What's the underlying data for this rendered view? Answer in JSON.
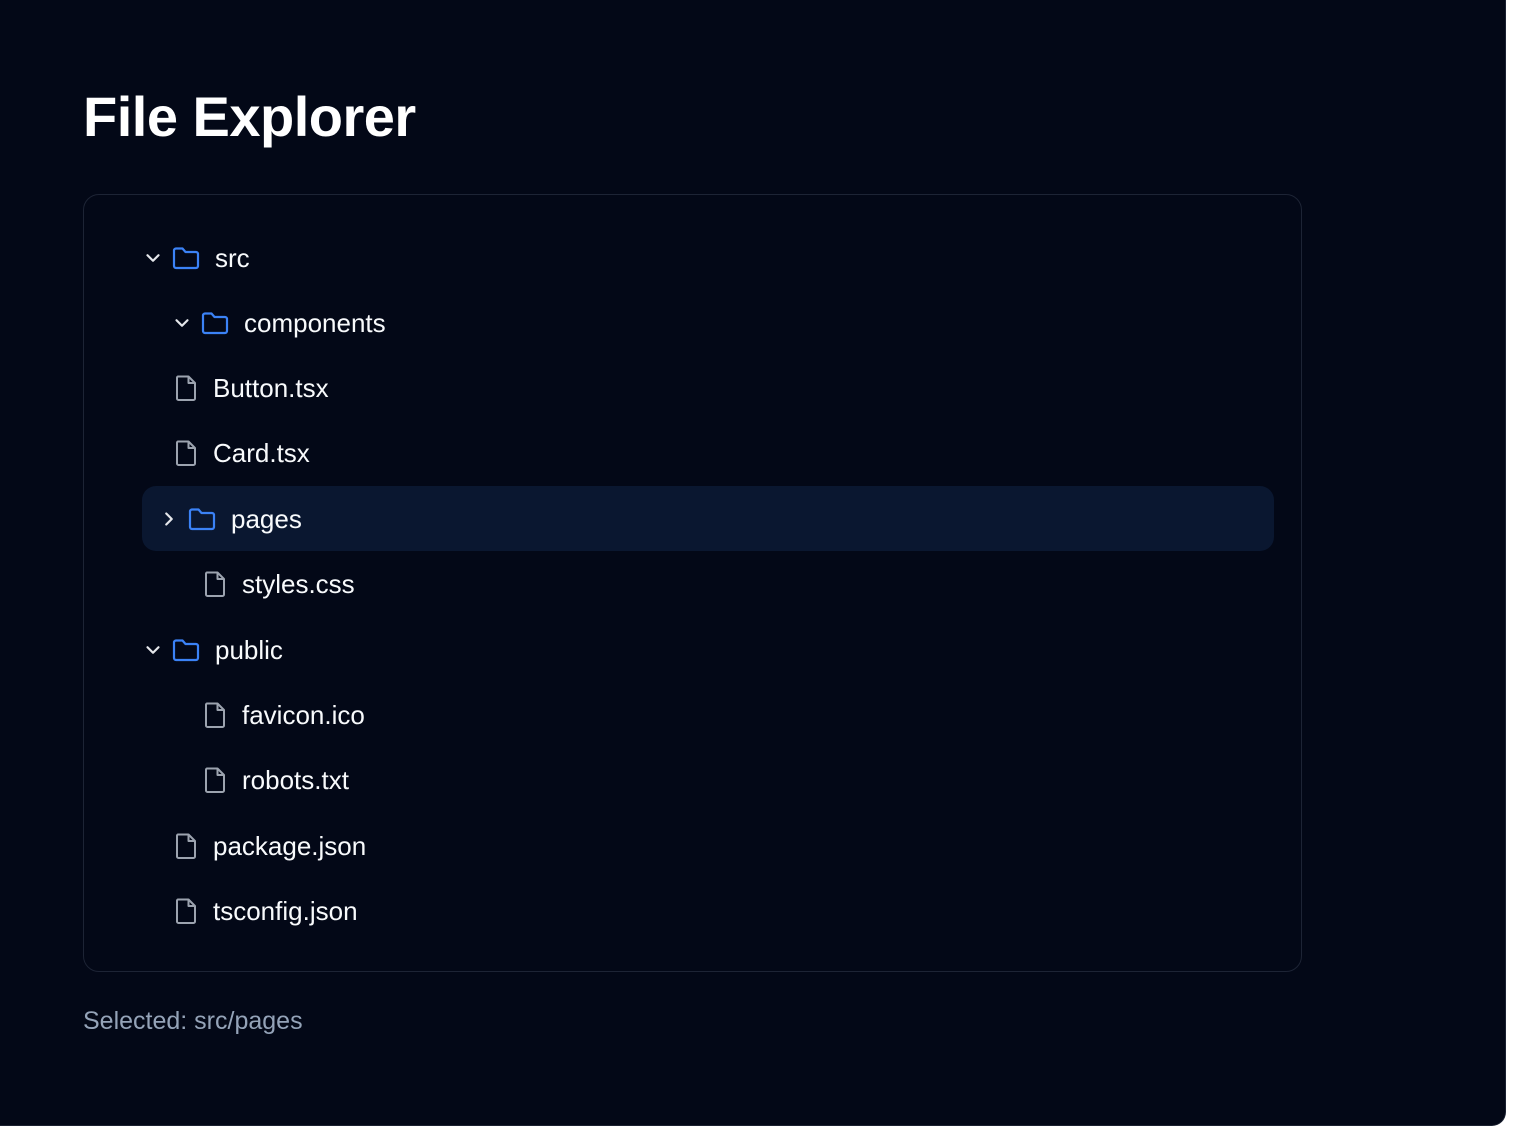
{
  "header": {
    "title": "File Explorer"
  },
  "colors": {
    "background": "#030817",
    "folder_icon": "#3b82f6",
    "file_icon": "#9ca3af",
    "selected_row": "#0a1730",
    "status_text": "#94a3b8"
  },
  "tree": {
    "items": [
      {
        "label": "src",
        "kind": "folder",
        "depth": 0,
        "expanded": true
      },
      {
        "label": "components",
        "kind": "folder",
        "depth": 1,
        "expanded": true
      },
      {
        "label": "Button.tsx",
        "kind": "file",
        "depth": 1
      },
      {
        "label": "Card.tsx",
        "kind": "file",
        "depth": 1
      },
      {
        "label": "pages",
        "kind": "folder",
        "depth": 1,
        "expanded": false,
        "selected": true
      },
      {
        "label": "styles.css",
        "kind": "file",
        "depth": 2
      },
      {
        "label": "public",
        "kind": "folder",
        "depth": 0,
        "expanded": true
      },
      {
        "label": "favicon.ico",
        "kind": "file",
        "depth": 2
      },
      {
        "label": "robots.txt",
        "kind": "file",
        "depth": 2
      },
      {
        "label": "package.json",
        "kind": "file",
        "depth": 1
      },
      {
        "label": "tsconfig.json",
        "kind": "file",
        "depth": 1
      }
    ]
  },
  "status": {
    "selected_text": "Selected: src/pages"
  }
}
